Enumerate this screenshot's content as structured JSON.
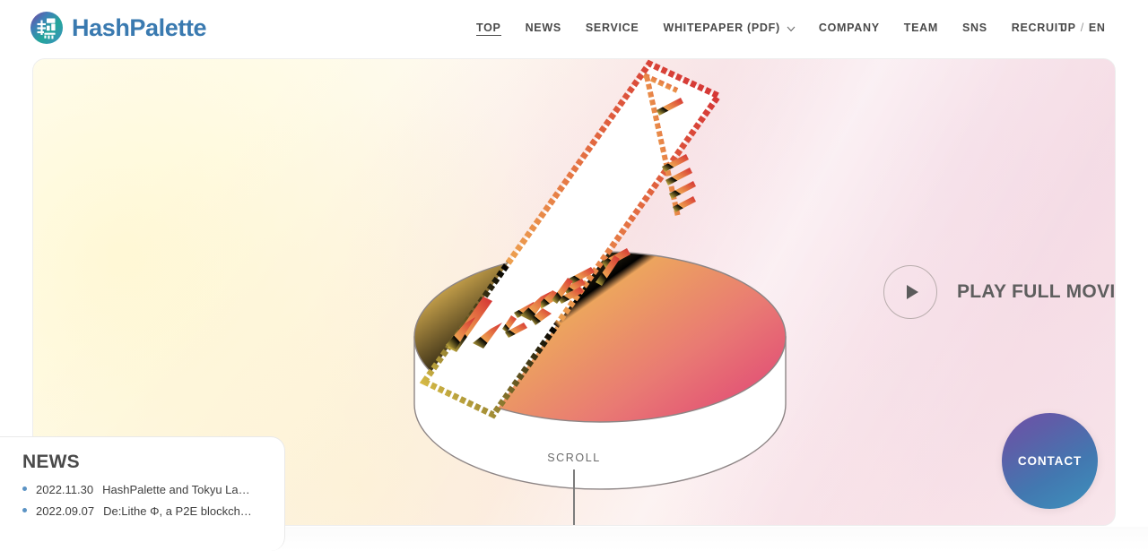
{
  "brand": {
    "name": "HashPalette",
    "logo_icon": "hashpalette-circle-logo",
    "color": "#3a7ab0"
  },
  "nav": {
    "items": [
      {
        "label": "TOP",
        "active": true
      },
      {
        "label": "NEWS",
        "active": false
      },
      {
        "label": "SERVICE",
        "active": false
      },
      {
        "label": "WHITEPAPER (PDF)",
        "active": false,
        "has_dropdown": true,
        "dropdown_icon": "chevron-down-icon"
      },
      {
        "label": "COMPANY",
        "active": false
      },
      {
        "label": "TEAM",
        "active": false
      },
      {
        "label": "SNS",
        "active": false
      },
      {
        "label": "RECRUIT",
        "active": false
      }
    ],
    "language": {
      "jp": "JP",
      "separator": "/",
      "en": "EN"
    }
  },
  "hero": {
    "artwork": {
      "ticket_word": "TICKET",
      "style": "isometric-pixel-ticket-on-cylinder",
      "gradient_from": "#f5d358",
      "gradient_to": "#d93a34",
      "disc_gradient_from": "#eeb752",
      "disc_gradient_to": "#e2496f"
    },
    "play": {
      "label": "PLAY FULL MOVIE",
      "icon": "play-triangle-icon"
    },
    "scroll": {
      "label": "SCROLL"
    },
    "background_colors": {
      "top_left": "#fffefa",
      "mid": "#fbeceb",
      "right": "#f3d8e4",
      "bottom_left": "#fdf0d6"
    }
  },
  "contact": {
    "label": "CONTACT",
    "gradient_from": "#6f4fa8",
    "gradient_to": "#3e92bd"
  },
  "news": {
    "title": "NEWS",
    "items": [
      {
        "date": "2022.11.30",
        "text": "HashPalette and Tokyu La…"
      },
      {
        "date": "2022.09.07",
        "text": "De:Lithe Φ, a P2E blockch…"
      }
    ]
  }
}
